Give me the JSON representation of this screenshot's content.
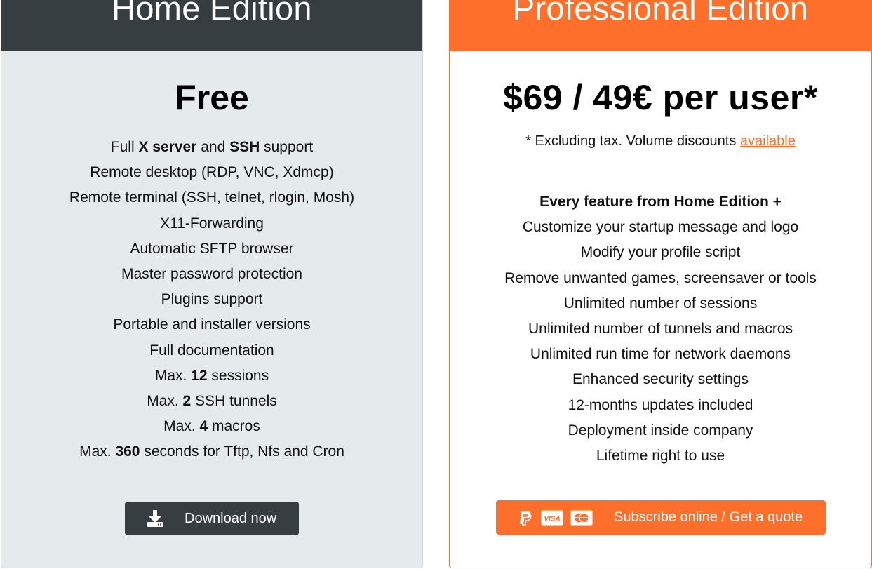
{
  "home": {
    "title": "Home Edition",
    "price": "Free",
    "features": [
      [
        {
          "t": "Full ",
          "b": false
        },
        {
          "t": "X server",
          "b": true
        },
        {
          "t": " and ",
          "b": false
        },
        {
          "t": "SSH",
          "b": true
        },
        {
          "t": " support",
          "b": false
        }
      ],
      [
        {
          "t": "Remote desktop (RDP, VNC, Xdmcp)",
          "b": false
        }
      ],
      [
        {
          "t": "Remote terminal (SSH, telnet, rlogin, Mosh)",
          "b": false
        }
      ],
      [
        {
          "t": "X11-Forwarding",
          "b": false
        }
      ],
      [
        {
          "t": "Automatic SFTP browser",
          "b": false
        }
      ],
      [
        {
          "t": "Master password protection",
          "b": false
        }
      ],
      [
        {
          "t": "Plugins support",
          "b": false
        }
      ],
      [
        {
          "t": "Portable and installer versions",
          "b": false
        }
      ],
      [
        {
          "t": "Full documentation",
          "b": false
        }
      ],
      [
        {
          "t": "Max. ",
          "b": false
        },
        {
          "t": "12",
          "b": true
        },
        {
          "t": " sessions",
          "b": false
        }
      ],
      [
        {
          "t": "Max. ",
          "b": false
        },
        {
          "t": "2",
          "b": true
        },
        {
          "t": " SSH tunnels",
          "b": false
        }
      ],
      [
        {
          "t": "Max. ",
          "b": false
        },
        {
          "t": "4",
          "b": true
        },
        {
          "t": " macros",
          "b": false
        }
      ],
      [
        {
          "t": "Max. ",
          "b": false
        },
        {
          "t": "360",
          "b": true
        },
        {
          "t": " seconds for Tftp, Nfs and Cron",
          "b": false
        }
      ]
    ],
    "download_label": "Download now",
    "download_icon": "download-icon"
  },
  "pro": {
    "title": "Professional Edition",
    "price": "$69 / 49€ per user*",
    "note_text": "* Excluding tax. Volume discounts ",
    "note_link": "available",
    "features": [
      [
        {
          "t": "Every feature from Home Edition +",
          "b": true
        }
      ],
      [
        {
          "t": "Customize your startup message and logo",
          "b": false
        }
      ],
      [
        {
          "t": "Modify your profile script",
          "b": false
        }
      ],
      [
        {
          "t": "Remove unwanted games, screensaver or tools",
          "b": false
        }
      ],
      [
        {
          "t": "Unlimited number of sessions",
          "b": false
        }
      ],
      [
        {
          "t": "Unlimited number of tunnels and macros",
          "b": false
        }
      ],
      [
        {
          "t": "Unlimited run time for network daemons",
          "b": false
        }
      ],
      [
        {
          "t": "Enhanced security settings",
          "b": false
        }
      ],
      [
        {
          "t": "12-months updates included",
          "b": false
        }
      ],
      [
        {
          "t": "Deployment inside company",
          "b": false
        }
      ],
      [
        {
          "t": "Lifetime right to use",
          "b": false
        }
      ]
    ],
    "subscribe_label": "Subscribe online / Get a quote",
    "payment_icons": [
      "paypal-icon",
      "visa-icon",
      "mastercard-icon"
    ],
    "visa_text": "VISA"
  },
  "colors": {
    "home_header": "#373e42",
    "home_bg": "#e5eaec",
    "pro_accent": "#ff6f2c"
  }
}
